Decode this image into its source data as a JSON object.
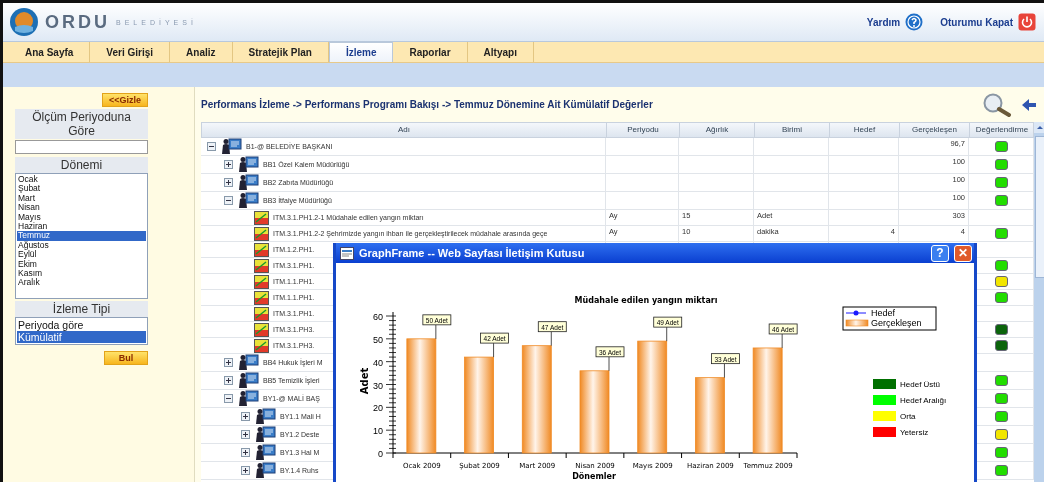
{
  "header": {
    "logo_main": "ORDU",
    "logo_sub": "BELEDİYESİ",
    "help": "Yardım",
    "logout": "Oturumu Kapat"
  },
  "tabs": [
    {
      "label": "Ana Sayfa",
      "selected": false
    },
    {
      "label": "Veri Girişi",
      "selected": false
    },
    {
      "label": "Analiz",
      "selected": false
    },
    {
      "label": "Stratejik Plan",
      "selected": false
    },
    {
      "label": "İzleme",
      "selected": true
    },
    {
      "label": "Raporlar",
      "selected": false
    },
    {
      "label": "Altyapı",
      "selected": false
    }
  ],
  "sidebar": {
    "hide_button": "<<Gizle",
    "measure_label": "Ölçüm Periyoduna Göre",
    "period_label": "Dönemi",
    "months": [
      {
        "label": "Ocak",
        "selected": false
      },
      {
        "label": "Şubat",
        "selected": false
      },
      {
        "label": "Mart",
        "selected": false
      },
      {
        "label": "Nisan",
        "selected": false
      },
      {
        "label": "Mayıs",
        "selected": false
      },
      {
        "label": "Haziran",
        "selected": false
      },
      {
        "label": "Temmuz",
        "selected": true
      },
      {
        "label": "Ağustos",
        "selected": false
      },
      {
        "label": "Eylül",
        "selected": false
      },
      {
        "label": "Ekim",
        "selected": false
      },
      {
        "label": "Kasım",
        "selected": false
      },
      {
        "label": "Aralık",
        "selected": false
      }
    ],
    "type_label": "İzleme Tipi",
    "types": [
      {
        "label": "Periyoda göre",
        "selected": false
      },
      {
        "label": "Kümülatif",
        "selected": true
      }
    ],
    "find_button": "Bul"
  },
  "breadcrumb": "Performans İzleme -> Performans Programı Bakışı -> Temmuz Dönemine Ait Kümülatif Değerler",
  "table": {
    "columns": [
      "Adı",
      "Periyodu",
      "Ağırlık",
      "Birimi",
      "Hedef",
      "Gerçekleşen",
      "Değerlendirme"
    ],
    "rows": [
      {
        "kind": "department",
        "name": "B1-@ BELEDİYE BAŞKANI",
        "expanded": true,
        "actual": "96,7",
        "color": "#22dd00",
        "children": [
          {
            "kind": "department",
            "name": "BB1 Özel Kalem Müdürlüğü",
            "expanded": false,
            "actual": "100",
            "color": "#22dd00"
          },
          {
            "kind": "department",
            "name": "BB2 Zabıta Müdürlüğü",
            "expanded": false,
            "actual": "100",
            "color": "#22dd00"
          },
          {
            "kind": "department",
            "name": "BB3 İtfaiye Müdürlüğü",
            "expanded": true,
            "actual": "100",
            "color": "#22dd00",
            "children": [
              {
                "kind": "indicator",
                "name": "ITM.3.1.PH1.2-1 Müdahale edilen yangın miktarı",
                "period": "Ay",
                "weight": "15",
                "unit": "Adet",
                "actual": "303"
              },
              {
                "kind": "indicator",
                "name": "ITM.3.1.PH1.2-2 Şehrimizde yangın ihbarı ile gerçekleştirilecek müdahale arasında geçe",
                "period": "Ay",
                "weight": "10",
                "unit": "dakika",
                "target": "4",
                "actual": "4",
                "color": "#22dd00"
              },
              {
                "kind": "indicator",
                "name": "ITM.1.2.PH1."
              },
              {
                "kind": "indicator",
                "name": "ITM.3.1.PH1.",
                "color": "#22dd00"
              },
              {
                "kind": "indicator",
                "name": "ITM.1.1.PH1.",
                "color": "#f2e600"
              },
              {
                "kind": "indicator",
                "name": "ITM.1.1.PH1.",
                "color": "#22dd00"
              },
              {
                "kind": "indicator",
                "name": "ITM.3.1.PH1."
              },
              {
                "kind": "indicator",
                "name": "ITM.3.1.PH3.",
                "color": "#0b640b"
              },
              {
                "kind": "indicator",
                "name": "ITM.3.1.PH3.",
                "color": "#0b640b"
              }
            ]
          },
          {
            "kind": "department",
            "name": "BB4 Hukuk İşleri M",
            "expanded": false
          },
          {
            "kind": "department",
            "name": "BB5 Temizlik İşleri",
            "expanded": false,
            "color": "#22dd00"
          },
          {
            "kind": "department",
            "name": "BY1-@ MALİ BAŞ",
            "expanded": true,
            "color": "#22dd00",
            "children": [
              {
                "kind": "department",
                "name": "BY1.1 Mali H",
                "expanded": false,
                "color": "#22dd00"
              },
              {
                "kind": "department",
                "name": "BY1.2 Deste",
                "expanded": false,
                "color": "#f2e600"
              },
              {
                "kind": "department",
                "name": "BY1.3 Hal M",
                "expanded": false,
                "color": "#22dd00"
              },
              {
                "kind": "department",
                "name": "BY.1.4 Ruhs",
                "expanded": false,
                "color": "#22dd00"
              }
            ]
          }
        ]
      }
    ]
  },
  "dialog": {
    "title": "GraphFrame -- Web Sayfası İletişim Kutusu",
    "help_button": "?",
    "close_button": "✕",
    "chart_data": {
      "type": "bar",
      "title": "Müdahale edilen yangın miktarı",
      "xlabel": "Dönemler",
      "ylabel": "Adet",
      "categories": [
        "Ocak  2009",
        "Şubat  2009",
        "Mart  2009",
        "Nisan  2009",
        "Mayıs  2009",
        "Haziran  2009",
        "Temmuz  2009"
      ],
      "series": [
        {
          "name": "Gerçekleşen",
          "color": "#f08a24",
          "values": [
            50,
            42,
            47,
            36,
            49,
            33,
            46
          ]
        }
      ],
      "ylim": [
        0,
        60
      ],
      "yticks": [
        0,
        10,
        20,
        30,
        40,
        50,
        60
      ],
      "value_labels": [
        "50 Adet",
        "42 Adet",
        "47 Adet",
        "36 Adet",
        "49 Adet",
        "33 Adet",
        "46 Adet"
      ]
    },
    "legend": [
      {
        "kind": "line",
        "label": "Hedef"
      }
    ],
    "color_key": [
      {
        "label": "Hedef Üstü",
        "color": "#007000"
      },
      {
        "label": "Hedef Aralığı",
        "color": "#00ff00"
      },
      {
        "label": "Orta",
        "color": "#ffff00"
      },
      {
        "label": "Yetersiz",
        "color": "#ff0000"
      }
    ]
  }
}
